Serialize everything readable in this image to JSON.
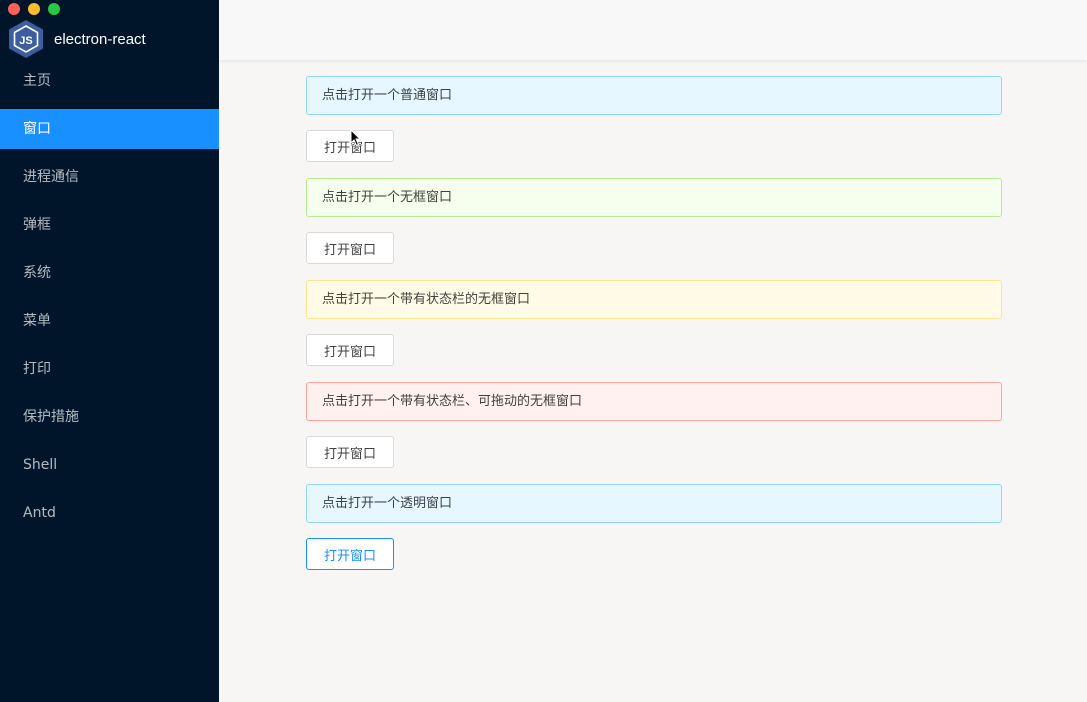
{
  "window": {
    "traffic_colors": [
      "#fe5f57",
      "#febc2e",
      "#28c840"
    ]
  },
  "sidebar": {
    "app_title": "electron-react",
    "logo_icon": "nodejs-hex-logo",
    "items": [
      {
        "label": "主页",
        "active": false
      },
      {
        "label": "窗口",
        "active": true
      },
      {
        "label": "进程通信",
        "active": false
      },
      {
        "label": "弹框",
        "active": false
      },
      {
        "label": "系统",
        "active": false
      },
      {
        "label": "菜单",
        "active": false
      },
      {
        "label": "打印",
        "active": false
      },
      {
        "label": "保护措施",
        "active": false
      },
      {
        "label": "Shell",
        "active": false
      },
      {
        "label": "Antd",
        "active": false
      }
    ]
  },
  "main": {
    "sections": [
      {
        "alert": "点击打开一个普通窗口",
        "alert_type": "info",
        "button": "打开窗口"
      },
      {
        "alert": "点击打开一个无框窗口",
        "alert_type": "success",
        "button": "打开窗口"
      },
      {
        "alert": "点击打开一个带有状态栏的无框窗口",
        "alert_type": "warning",
        "button": "打开窗口"
      },
      {
        "alert": "点击打开一个带有状态栏、可拖动的无框窗口",
        "alert_type": "error",
        "button": "打开窗口"
      },
      {
        "alert": "点击打开一个透明窗口",
        "alert_type": "info",
        "button": "打开窗口"
      }
    ]
  },
  "colors": {
    "sidebar_bg": "#001529",
    "accent": "#1890ff",
    "info_bg": "#e6f7ff",
    "success_bg": "#f6ffed",
    "warning_bg": "#fffbe6",
    "error_bg": "#fff1f0"
  }
}
